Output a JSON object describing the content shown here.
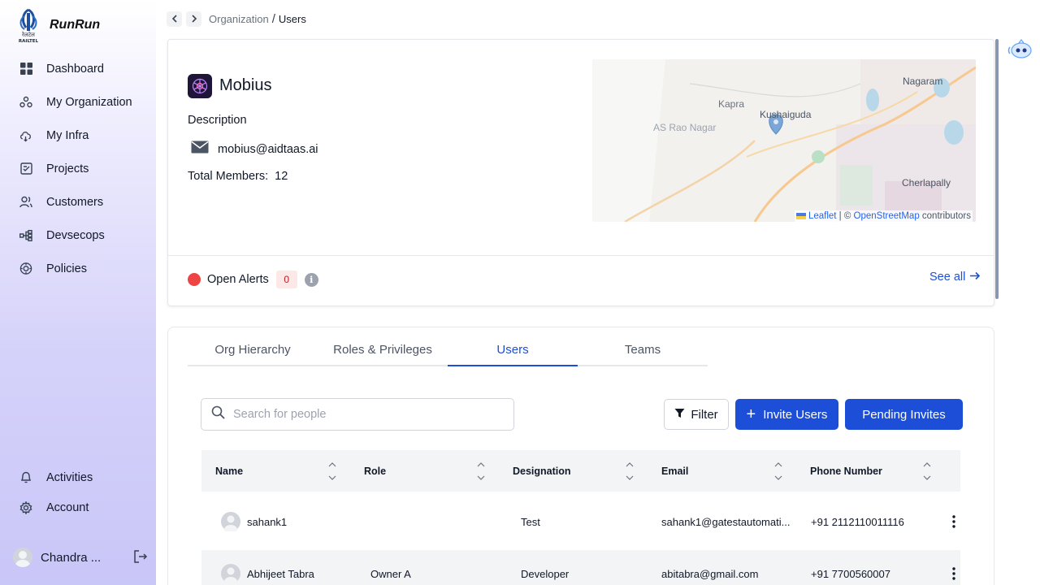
{
  "app": {
    "name": "RunRun",
    "logo_text": "रेलटेल RAILTEL"
  },
  "sidebar": {
    "items": [
      {
        "label": "Dashboard",
        "icon": "grid-icon"
      },
      {
        "label": "My Organization",
        "icon": "org-icon"
      },
      {
        "label": "My Infra",
        "icon": "cloud-icon"
      },
      {
        "label": "Projects",
        "icon": "projects-icon"
      },
      {
        "label": "Customers",
        "icon": "users-icon"
      },
      {
        "label": "Devsecops",
        "icon": "devsecops-icon"
      },
      {
        "label": "Policies",
        "icon": "policies-icon"
      }
    ],
    "bottom": [
      {
        "label": "Activities",
        "icon": "bell-icon"
      },
      {
        "label": "Account",
        "icon": "gear-icon"
      }
    ],
    "user": {
      "name": "Chandra ..."
    }
  },
  "breadcrumb": {
    "parent": "Organization",
    "separator": "/",
    "current": "Users"
  },
  "org": {
    "name": "Mobius",
    "description_label": "Description",
    "email": "mobius@aidtaas.ai",
    "members_label": "Total Members:",
    "members_count": "12",
    "map": {
      "labels": [
        "Nagaram",
        "Kapra",
        "Kushaiguda",
        "AS Rao Nagar",
        "Cherlapally"
      ],
      "attribution_leaflet": "Leaflet",
      "attribution_sep": " | © ",
      "attribution_osm": "OpenStreetMap",
      "attribution_suffix": " contributors"
    },
    "alerts": {
      "label": "Open Alerts",
      "count": "0",
      "see_all": "See all"
    }
  },
  "tabs": [
    {
      "label": "Org Hierarchy",
      "active": false
    },
    {
      "label": "Roles & Privileges",
      "active": false
    },
    {
      "label": "Users",
      "active": true
    },
    {
      "label": "Teams",
      "active": false
    }
  ],
  "toolbar": {
    "search_placeholder": "Search for people",
    "filter_label": "Filter",
    "invite_label": "Invite Users",
    "pending_label": "Pending Invites"
  },
  "table": {
    "columns": [
      "Name",
      "Role",
      "Designation",
      "Email",
      "Phone Number"
    ],
    "rows": [
      {
        "name": "sahank1",
        "role": "",
        "designation": "Test",
        "email": "sahank1@gatestautomati...",
        "phone": "+91 2112110011116"
      },
      {
        "name": "Abhijeet Tabra",
        "role": "Owner A",
        "designation": "Developer",
        "email": "abitabra@gmail.com",
        "phone": "+91 7700560007"
      }
    ]
  },
  "colors": {
    "primary": "#1d4ed8",
    "alert": "#ef4444",
    "sidebar_bottom": "#c9c6f8"
  }
}
